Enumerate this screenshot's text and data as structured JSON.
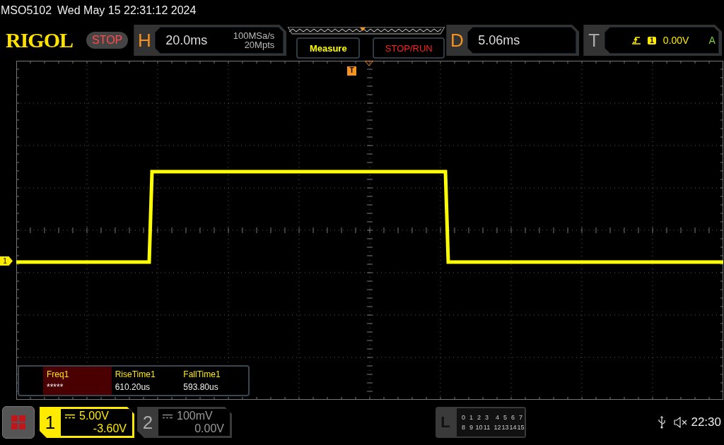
{
  "status_line": {
    "model": "MSO5102",
    "datetime": "Wed May 15 22:31:12 2024"
  },
  "header": {
    "logo": "RIGOL",
    "run_state": "STOP",
    "horizontal": {
      "label": "H",
      "timebase": "20.0ms",
      "sample_rate": "100MSa/s",
      "memory_depth": "20Mpts"
    },
    "buttons": [
      {
        "label": "Measure",
        "kind": "measure"
      },
      {
        "label": "STOP/RUN",
        "kind": "stoprun"
      }
    ],
    "delay": {
      "label": "D",
      "value": "5.06ms"
    },
    "trigger": {
      "label": "T",
      "source": "1",
      "level": "0.00V",
      "mode": "A"
    }
  },
  "display": {
    "channel_marker": "1",
    "trigger_marker": "T"
  },
  "measurements": [
    {
      "name": "Freq1",
      "value": "*****",
      "highlighted": true
    },
    {
      "name": "RiseTime1",
      "value": "610.20us",
      "highlighted": false
    },
    {
      "name": "FallTime1",
      "value": "593.80us",
      "highlighted": false
    }
  ],
  "bottom_bar": {
    "channels": [
      {
        "number": "1",
        "scale": "5.00V",
        "offset": "-3.60V",
        "active": true
      },
      {
        "number": "2",
        "scale": "100mV",
        "offset": "0.00V",
        "active": false
      }
    ],
    "logic": {
      "label": "L",
      "rows": [
        [
          "0",
          "1",
          "2",
          "3",
          "4",
          "5",
          "6",
          "7"
        ],
        [
          "8",
          "9",
          "10",
          "11",
          "12",
          "13",
          "14",
          "15"
        ]
      ]
    },
    "time": "22:30"
  }
}
